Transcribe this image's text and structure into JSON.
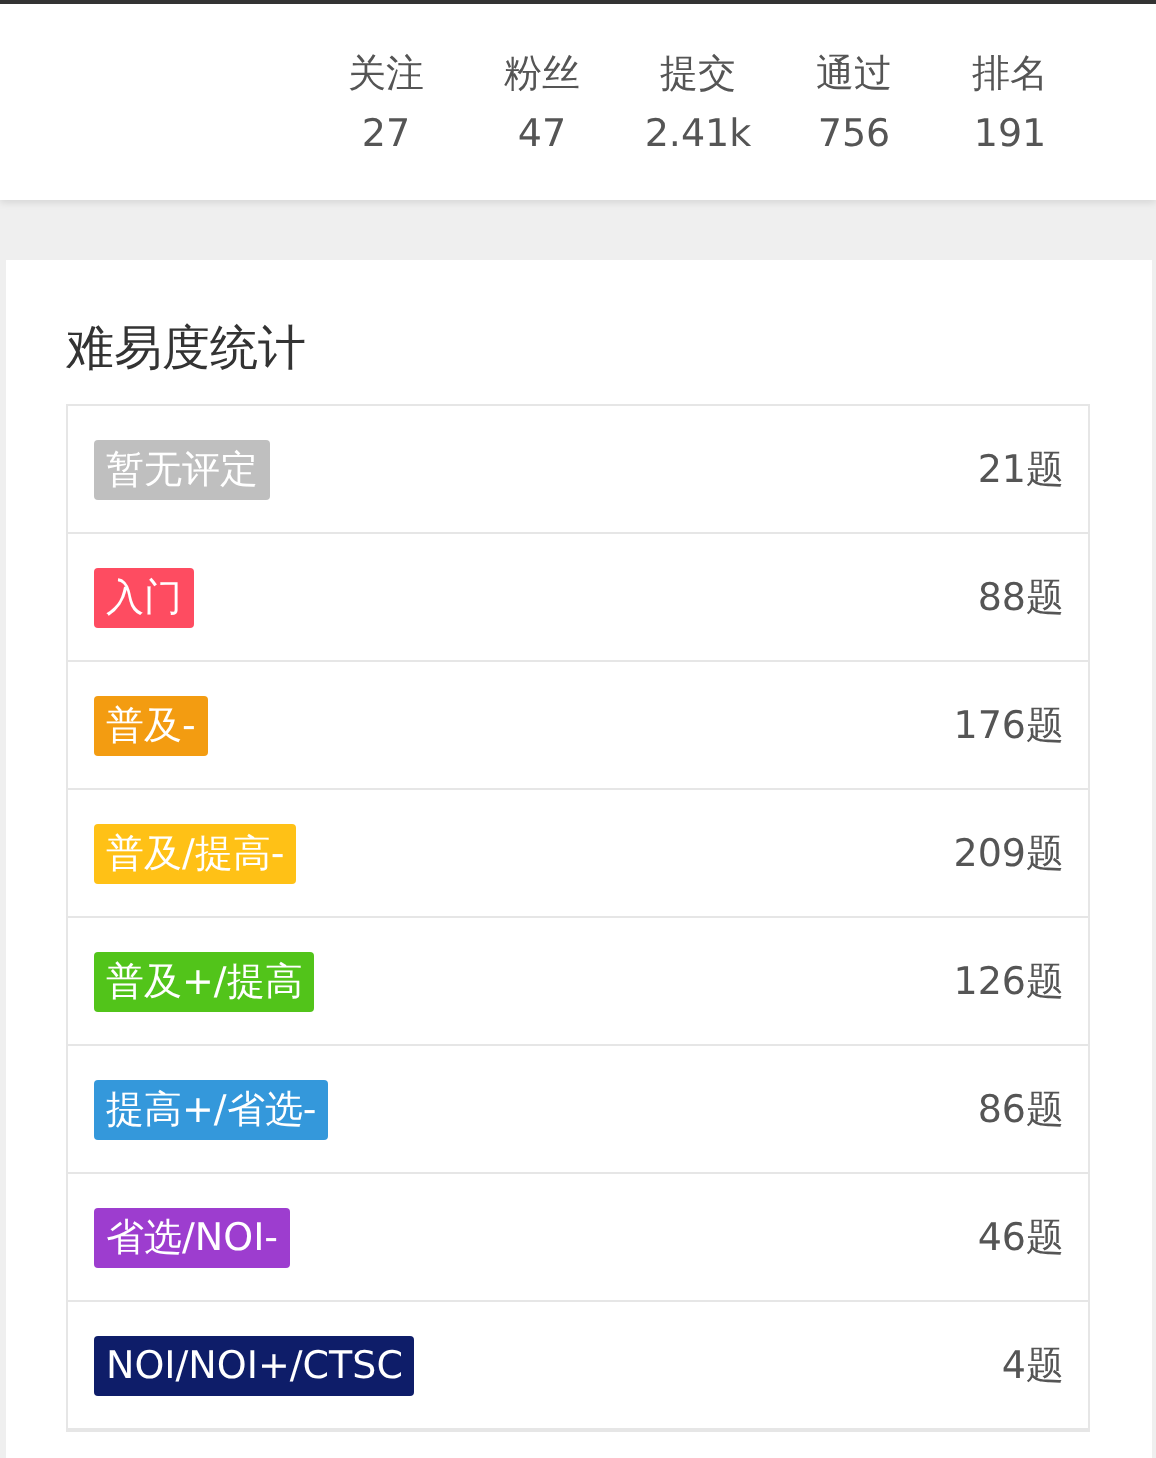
{
  "stats": [
    {
      "label": "关注",
      "value": "27"
    },
    {
      "label": "粉丝",
      "value": "47"
    },
    {
      "label": "提交",
      "value": "2.41k"
    },
    {
      "label": "通过",
      "value": "756"
    },
    {
      "label": "排名",
      "value": "191"
    }
  ],
  "difficulty": {
    "title": "难易度统计",
    "rows": [
      {
        "tag": "暂无评定",
        "color": "#bfbfbf",
        "count": "21题"
      },
      {
        "tag": "入门",
        "color": "#fe4c61",
        "count": "88题"
      },
      {
        "tag": "普及-",
        "color": "#f39c11",
        "count": "176题"
      },
      {
        "tag": "普及/提高-",
        "color": "#ffc116",
        "count": "209题"
      },
      {
        "tag": "普及+/提高",
        "color": "#52c41a",
        "count": "126题"
      },
      {
        "tag": "提高+/省选-",
        "color": "#3498db",
        "count": "86题"
      },
      {
        "tag": "省选/NOI-",
        "color": "#9d3dcf",
        "count": "46题"
      },
      {
        "tag": "NOI/NOI+/CTSC",
        "color": "#0e1d69",
        "count": "4题"
      }
    ]
  }
}
